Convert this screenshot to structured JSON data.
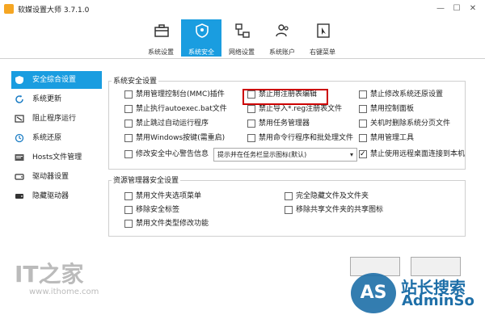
{
  "window": {
    "title": "软媒设置大师 3.7.1.0",
    "controls": [
      "最小化",
      "最大化",
      "关闭"
    ]
  },
  "toolbar": {
    "tabs": [
      {
        "label": "系统设置",
        "icon": "toolbox-icon",
        "active": false
      },
      {
        "label": "系统安全",
        "icon": "shield-icon",
        "active": true
      },
      {
        "label": "网络设置",
        "icon": "network-icon",
        "active": false
      },
      {
        "label": "系统账户",
        "icon": "users-icon",
        "active": false
      },
      {
        "label": "右键菜单",
        "icon": "cursor-icon",
        "active": false
      }
    ]
  },
  "sidebar": {
    "items": [
      {
        "label": "安全综合设置",
        "icon": "shield-icon",
        "active": true
      },
      {
        "label": "系统更新",
        "icon": "refresh-icon",
        "active": false
      },
      {
        "label": "阻止程序运行",
        "icon": "block-icon",
        "active": false
      },
      {
        "label": "系统还原",
        "icon": "restore-icon",
        "active": false
      },
      {
        "label": "Hosts文件管理",
        "icon": "hosts-icon",
        "active": false
      },
      {
        "label": "驱动器设置",
        "icon": "drive-icon",
        "active": false
      },
      {
        "label": "隐藏驱动器",
        "icon": "hidden-drive-icon",
        "active": false
      }
    ]
  },
  "security_group": {
    "title": "系统安全设置",
    "checkboxes": [
      {
        "label": "禁用管理控制台(MMC)插件",
        "checked": false
      },
      {
        "label": "禁止用注册表编辑",
        "checked": false
      },
      {
        "label": "禁止修改系统还原设置",
        "checked": false
      },
      {
        "label": "禁止执行autoexec.bat文件",
        "checked": false
      },
      {
        "label": "禁止导入*.reg注册表文件",
        "checked": false
      },
      {
        "label": "禁用控制面板",
        "checked": false
      },
      {
        "label": "禁止跳过自动运行程序",
        "checked": false
      },
      {
        "label": "禁用任务管理器",
        "checked": false
      },
      {
        "label": "关机时删除系统分页文件",
        "checked": false
      },
      {
        "label": "禁用Windows按键(需重启)",
        "checked": false
      },
      {
        "label": "禁用命令行程序和批处理文件",
        "checked": false
      },
      {
        "label": "禁用管理工具",
        "checked": false
      },
      {
        "label": "修改安全中心警告信息",
        "checked": false
      },
      {
        "label": "禁止使用远程桌面连接到本机",
        "checked": true
      }
    ],
    "select_value": "提示并在任务栏显示图标(默认)"
  },
  "explorer_group": {
    "title": "资源管理器安全设置",
    "checkboxes": [
      {
        "label": "禁用文件夹选项菜单",
        "checked": false
      },
      {
        "label": "完全隐藏文件及文件夹",
        "checked": false
      },
      {
        "label": "移除安全标签",
        "checked": false
      },
      {
        "label": "移除共享文件夹的共享图标",
        "checked": false
      },
      {
        "label": "禁用文件类型修改功能",
        "checked": false
      }
    ]
  },
  "watermark": {
    "it_logo": "IT之家",
    "site": "www.ithome.com",
    "as_logo": "AS",
    "brand_cn": "站长搜索",
    "brand_en": "AdminSo"
  }
}
